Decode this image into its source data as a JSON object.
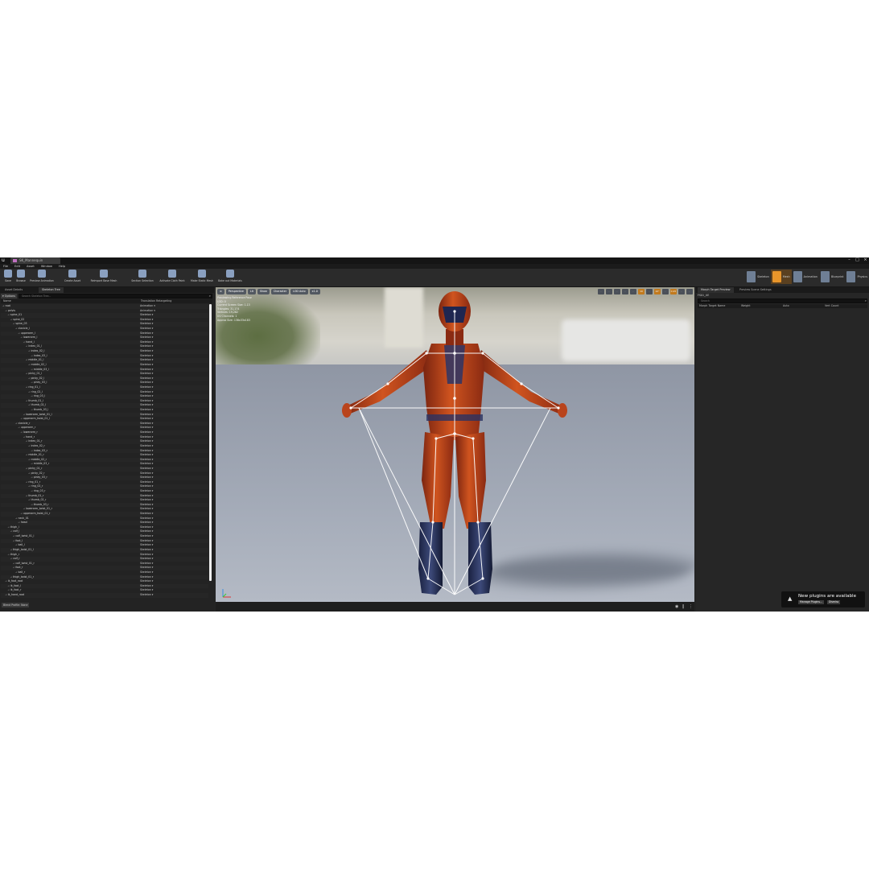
{
  "window": {
    "tab_title": "SK_Mannequin"
  },
  "menu": [
    "File",
    "Edit",
    "Asset",
    "Window",
    "Help"
  ],
  "toolbar": [
    {
      "label": "Save",
      "icon": "save-icon"
    },
    {
      "label": "Browse",
      "icon": "browse-icon"
    },
    {
      "label": "Preview Animation",
      "icon": "preview-animation-icon"
    },
    {
      "label": "Create Asset",
      "icon": "create-asset-icon"
    },
    {
      "label": "Reimport Base Mesh",
      "icon": "reimport-icon"
    },
    {
      "label": "Section Selection",
      "icon": "section-selection-icon"
    },
    {
      "label": "Activate Cloth Paint",
      "icon": "cloth-paint-icon"
    },
    {
      "label": "Make Static Mesh",
      "icon": "static-mesh-icon"
    },
    {
      "label": "Bake out Materials",
      "icon": "bake-materials-icon"
    }
  ],
  "modes": [
    {
      "label": "Skeleton",
      "active": false
    },
    {
      "label": "Mesh",
      "active": true
    },
    {
      "label": "Animation",
      "active": false
    },
    {
      "label": "Blueprint",
      "active": false
    },
    {
      "label": "Physics",
      "active": false
    }
  ],
  "left_panel": {
    "tabs": [
      "Asset Details",
      "Skeleton Tree"
    ],
    "options_label": "Options",
    "search_placeholder": "Search Skeleton Tree...",
    "columns": [
      "Name",
      "Translation Retargeting"
    ],
    "rows": [
      {
        "name": "root",
        "depth": 0,
        "retarget": "Animation"
      },
      {
        "name": "pelvis",
        "depth": 1,
        "retarget": "Animation"
      },
      {
        "name": "spine_01",
        "depth": 2,
        "retarget": "Skeleton"
      },
      {
        "name": "spine_02",
        "depth": 3,
        "retarget": "Skeleton"
      },
      {
        "name": "spine_03",
        "depth": 4,
        "retarget": "Skeleton"
      },
      {
        "name": "clavicle_l",
        "depth": 5,
        "retarget": "Skeleton"
      },
      {
        "name": "upperarm_l",
        "depth": 6,
        "retarget": "Skeleton"
      },
      {
        "name": "lowerarm_l",
        "depth": 7,
        "retarget": "Skeleton"
      },
      {
        "name": "hand_l",
        "depth": 8,
        "retarget": "Skeleton"
      },
      {
        "name": "index_01_l",
        "depth": 9,
        "retarget": "Skeleton"
      },
      {
        "name": "index_02_l",
        "depth": 10,
        "retarget": "Skeleton"
      },
      {
        "name": "index_03_l",
        "depth": 11,
        "retarget": "Skeleton"
      },
      {
        "name": "middle_01_l",
        "depth": 9,
        "retarget": "Skeleton"
      },
      {
        "name": "middle_02_l",
        "depth": 10,
        "retarget": "Skeleton"
      },
      {
        "name": "middle_03_l",
        "depth": 11,
        "retarget": "Skeleton"
      },
      {
        "name": "pinky_01_l",
        "depth": 9,
        "retarget": "Skeleton"
      },
      {
        "name": "pinky_02_l",
        "depth": 10,
        "retarget": "Skeleton"
      },
      {
        "name": "pinky_03_l",
        "depth": 11,
        "retarget": "Skeleton"
      },
      {
        "name": "ring_01_l",
        "depth": 9,
        "retarget": "Skeleton"
      },
      {
        "name": "ring_02_l",
        "depth": 10,
        "retarget": "Skeleton"
      },
      {
        "name": "ring_03_l",
        "depth": 11,
        "retarget": "Skeleton"
      },
      {
        "name": "thumb_01_l",
        "depth": 9,
        "retarget": "Skeleton"
      },
      {
        "name": "thumb_02_l",
        "depth": 10,
        "retarget": "Skeleton"
      },
      {
        "name": "thumb_03_l",
        "depth": 11,
        "retarget": "Skeleton"
      },
      {
        "name": "lowerarm_twist_01_l",
        "depth": 8,
        "retarget": "Skeleton"
      },
      {
        "name": "upperarm_twist_01_l",
        "depth": 7,
        "retarget": "Skeleton"
      },
      {
        "name": "clavicle_r",
        "depth": 5,
        "retarget": "Skeleton"
      },
      {
        "name": "upperarm_r",
        "depth": 6,
        "retarget": "Skeleton"
      },
      {
        "name": "lowerarm_r",
        "depth": 7,
        "retarget": "Skeleton"
      },
      {
        "name": "hand_r",
        "depth": 8,
        "retarget": "Skeleton"
      },
      {
        "name": "index_01_r",
        "depth": 9,
        "retarget": "Skeleton"
      },
      {
        "name": "index_02_r",
        "depth": 10,
        "retarget": "Skeleton"
      },
      {
        "name": "index_03_r",
        "depth": 11,
        "retarget": "Skeleton"
      },
      {
        "name": "middle_01_r",
        "depth": 9,
        "retarget": "Skeleton"
      },
      {
        "name": "middle_02_r",
        "depth": 10,
        "retarget": "Skeleton"
      },
      {
        "name": "middle_03_r",
        "depth": 11,
        "retarget": "Skeleton"
      },
      {
        "name": "pinky_01_r",
        "depth": 9,
        "retarget": "Skeleton"
      },
      {
        "name": "pinky_02_r",
        "depth": 10,
        "retarget": "Skeleton"
      },
      {
        "name": "pinky_03_r",
        "depth": 11,
        "retarget": "Skeleton"
      },
      {
        "name": "ring_01_r",
        "depth": 9,
        "retarget": "Skeleton"
      },
      {
        "name": "ring_02_r",
        "depth": 10,
        "retarget": "Skeleton"
      },
      {
        "name": "ring_03_r",
        "depth": 11,
        "retarget": "Skeleton"
      },
      {
        "name": "thumb_01_r",
        "depth": 9,
        "retarget": "Skeleton"
      },
      {
        "name": "thumb_02_r",
        "depth": 10,
        "retarget": "Skeleton"
      },
      {
        "name": "thumb_03_r",
        "depth": 11,
        "retarget": "Skeleton"
      },
      {
        "name": "lowerarm_twist_01_r",
        "depth": 8,
        "retarget": "Skeleton"
      },
      {
        "name": "upperarm_twist_01_r",
        "depth": 7,
        "retarget": "Skeleton"
      },
      {
        "name": "neck_01",
        "depth": 5,
        "retarget": "Skeleton"
      },
      {
        "name": "head",
        "depth": 6,
        "retarget": "Skeleton"
      },
      {
        "name": "thigh_l",
        "depth": 2,
        "retarget": "Skeleton"
      },
      {
        "name": "calf_l",
        "depth": 3,
        "retarget": "Skeleton"
      },
      {
        "name": "calf_twist_01_l",
        "depth": 4,
        "retarget": "Skeleton"
      },
      {
        "name": "foot_l",
        "depth": 4,
        "retarget": "Skeleton"
      },
      {
        "name": "ball_l",
        "depth": 5,
        "retarget": "Skeleton"
      },
      {
        "name": "thigh_twist_01_l",
        "depth": 3,
        "retarget": "Skeleton"
      },
      {
        "name": "thigh_r",
        "depth": 2,
        "retarget": "Skeleton"
      },
      {
        "name": "calf_r",
        "depth": 3,
        "retarget": "Skeleton"
      },
      {
        "name": "calf_twist_01_r",
        "depth": 4,
        "retarget": "Skeleton"
      },
      {
        "name": "foot_r",
        "depth": 4,
        "retarget": "Skeleton"
      },
      {
        "name": "ball_r",
        "depth": 5,
        "retarget": "Skeleton"
      },
      {
        "name": "thigh_twist_01_r",
        "depth": 3,
        "retarget": "Skeleton"
      },
      {
        "name": "ik_foot_root",
        "depth": 1,
        "retarget": "Skeleton"
      },
      {
        "name": "ik_foot_l",
        "depth": 2,
        "retarget": "Skeleton"
      },
      {
        "name": "ik_foot_r",
        "depth": 2,
        "retarget": "Skeleton"
      },
      {
        "name": "ik_hand_root",
        "depth": 1,
        "retarget": "Skeleton"
      }
    ],
    "footer": [
      "Blend Profile: None"
    ]
  },
  "viewport": {
    "buttons": [
      "Perspective",
      "Lit",
      "Show",
      "Character",
      "LOD Auto",
      "x1.0"
    ],
    "right_icons": [
      "translate-icon",
      "rotate-icon",
      "scale-icon",
      "world-icon",
      "grid-snap-icon",
      "10",
      "angle-snap-icon",
      "10°",
      "scale-snap-icon",
      "0.25",
      "camera-speed-icon",
      "maximize-icon"
    ],
    "stats": [
      "Previewing Reference Pose",
      "LOD: 0",
      "Current Screen Size: 1.13",
      "Triangles: 31,174",
      "Vertices: 19,282",
      "UV Channels: 1",
      "Approx Size: 138x33x183"
    ]
  },
  "right_panel": {
    "tabs": [
      "Morph Target Preview",
      "Preview Scene Settings"
    ],
    "asset_name": "FS01_UE",
    "search_placeholder": "Search",
    "columns": [
      "Morph Target Name",
      "Weight",
      "Auto",
      "Vert Count"
    ]
  },
  "notification": {
    "title": "New plugins are available",
    "buttons": [
      "Manage Plugins...",
      "Dismiss"
    ]
  },
  "colors": {
    "accent": "#e8952a",
    "bone": "#ffffff",
    "suit": "#c2481e"
  }
}
